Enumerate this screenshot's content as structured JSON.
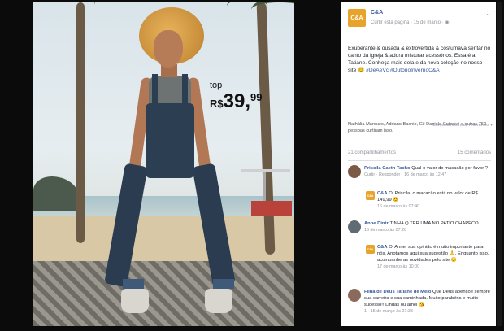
{
  "price_tag": {
    "label": "top",
    "currency": "R$",
    "integer": "39,",
    "decimal": "99"
  },
  "page": {
    "logo_text": "C&A",
    "name": "C&A",
    "meta": "Curtir esta página · 15 de março · ◉",
    "menu_icon": "chevron-down-icon"
  },
  "post": {
    "text": "Exuberante & ousada & extrovertida & costumava sentar no canto da igreja & adora misturar acessórios. Essa é a Tatiane. Conheça mais dela e da nova coleção no nosso site 😊",
    "hashtags": "#DeAeVc #OutonoInvernoC&A"
  },
  "likes": {
    "text": "Nathália Marques, Adriano Bachio, Gil Daniela Cutosrei e outras 752 pessoas curtiram isso.",
    "tag": "Comentários mais relevantes ▾"
  },
  "counts": {
    "shares": "21 compartilhamentos",
    "comments": "15 comentários"
  },
  "comments": [
    {
      "name": "Priscila Caetn Tacho",
      "text": "Qual o valor do macacão por favor ?",
      "meta": "Curtir · Responder · 16 de março às 12:47"
    },
    {
      "name": "C&A",
      "text": "Oi Priscila, o macacão está no valor de R$ 149,99 😊",
      "meta": "16 de março às 07:40"
    },
    {
      "name": "Anne Diniz",
      "text": "TINHA Q TER UMA NO PATIO CHAPECO",
      "meta": "16 de março às 07:28"
    },
    {
      "name": "C&A",
      "text": "Oi Anne, sua opinião é muito importante para nós. Anotamos aqui sua sugestão 🙏. Enquanto isso, acompanhe as novidades pelo site 😊",
      "meta": "17 de março às 10:00"
    },
    {
      "name": "Filha de Deus Tatiane de Melo",
      "text": "Que Deus abençoe sempre sua carreira e sua caminhada. Muito parabéns e muito sucesso!! Lindas ou amei 😘",
      "meta": "1 · 15 de março às 21:38"
    }
  ],
  "colors": {
    "brand": "#e8a42a",
    "link": "#365899"
  }
}
